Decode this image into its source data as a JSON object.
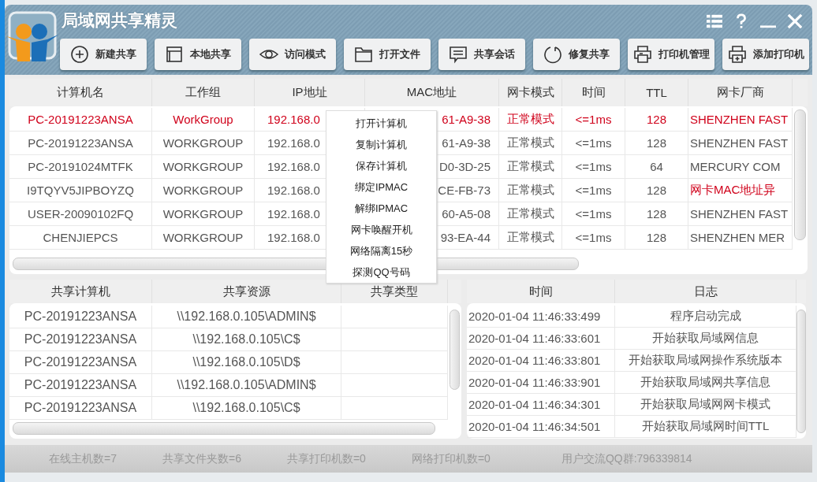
{
  "window": {
    "title": "局域网共享精灵"
  },
  "toolbar": [
    {
      "label": "新建共享"
    },
    {
      "label": "本地共享"
    },
    {
      "label": "访问模式"
    },
    {
      "label": "打开文件"
    },
    {
      "label": "共享会话"
    },
    {
      "label": "修复共享"
    },
    {
      "label": "打印机管理"
    },
    {
      "label": "添加打印机"
    }
  ],
  "hosts": {
    "columns": [
      "计算机名",
      "工作组",
      "IP地址",
      "MAC地址",
      "网卡模式",
      "时间",
      "TTL",
      "网卡厂商"
    ],
    "rows": [
      {
        "selected": true,
        "vendor_alert": false,
        "cells": [
          "PC-20191223ANSA",
          "WorkGroup",
          "192.168.0",
          "61-A9-38",
          "正常模式",
          "<=1ms",
          "128",
          "SHENZHEN FAST"
        ]
      },
      {
        "selected": false,
        "vendor_alert": false,
        "cells": [
          "PC-20191223ANSA",
          "WORKGROUP",
          "192.168.0",
          "61-A9-38",
          "正常模式",
          "<=1ms",
          "128",
          "SHENZHEN FAST"
        ]
      },
      {
        "selected": false,
        "vendor_alert": false,
        "cells": [
          "PC-20191024MTFK",
          "WORKGROUP",
          "192.168.0",
          "D0-3D-25",
          "正常模式",
          "<=1ms",
          "64",
          "MERCURY COM"
        ]
      },
      {
        "selected": false,
        "vendor_alert": true,
        "cells": [
          "I9TQYV5JIPBOYZQ",
          "WORKGROUP",
          "192.168.0",
          "CE-FB-73",
          "正常模式",
          "<=1ms",
          "128",
          "网卡MAC地址异"
        ]
      },
      {
        "selected": false,
        "vendor_alert": false,
        "cells": [
          "USER-20090102FQ",
          "WORKGROUP",
          "192.168.0",
          "60-A5-08",
          "正常模式",
          "<=1ms",
          "128",
          "SHENZHEN FAST"
        ]
      },
      {
        "selected": false,
        "vendor_alert": false,
        "cells": [
          "CHENJIEPCS",
          "WORKGROUP",
          "192.168.0",
          "93-EA-44",
          "正常模式",
          "<=1ms",
          "128",
          "SHENZHEN MER"
        ]
      }
    ]
  },
  "context_menu": [
    "打开计算机",
    "复制计算机",
    "保存计算机",
    "绑定IPMAC",
    "解绑IPMAC",
    "网卡唤醒开机",
    "网络隔离15秒",
    "探测QQ号码"
  ],
  "shares": {
    "columns": [
      "共享计算机",
      "共享资源",
      "共享类型"
    ],
    "rows": [
      [
        "PC-20191223ANSA",
        "\\\\192.168.0.105\\ADMIN$"
      ],
      [
        "PC-20191223ANSA",
        "\\\\192.168.0.105\\C$"
      ],
      [
        "PC-20191223ANSA",
        "\\\\192.168.0.105\\D$"
      ],
      [
        "PC-20191223ANSA",
        "\\\\192.168.0.105\\ADMIN$"
      ],
      [
        "PC-20191223ANSA",
        "\\\\192.168.0.105\\C$"
      ]
    ]
  },
  "log": {
    "columns": [
      "时间",
      "日志"
    ],
    "rows": [
      [
        "2020-01-04 11:46:33:499",
        "程序启动完成"
      ],
      [
        "2020-01-04 11:46:33:601",
        "开始获取局域网信息"
      ],
      [
        "2020-01-04 11:46:33:801",
        "开始获取局域网操作系统版本"
      ],
      [
        "2020-01-04 11:46:33:901",
        "开始获取局域网共享信息"
      ],
      [
        "2020-01-04 11:46:34:301",
        "开始获取局域网网卡模式"
      ],
      [
        "2020-01-04 11:46:34:501",
        "开始获取局域网时间TTL"
      ]
    ]
  },
  "status_bar": [
    "在线主机数=7",
    "共享文件夹数=6",
    "共享打印机数=0",
    "网络打印机数=0",
    "用户交流QQ群:796339814"
  ]
}
